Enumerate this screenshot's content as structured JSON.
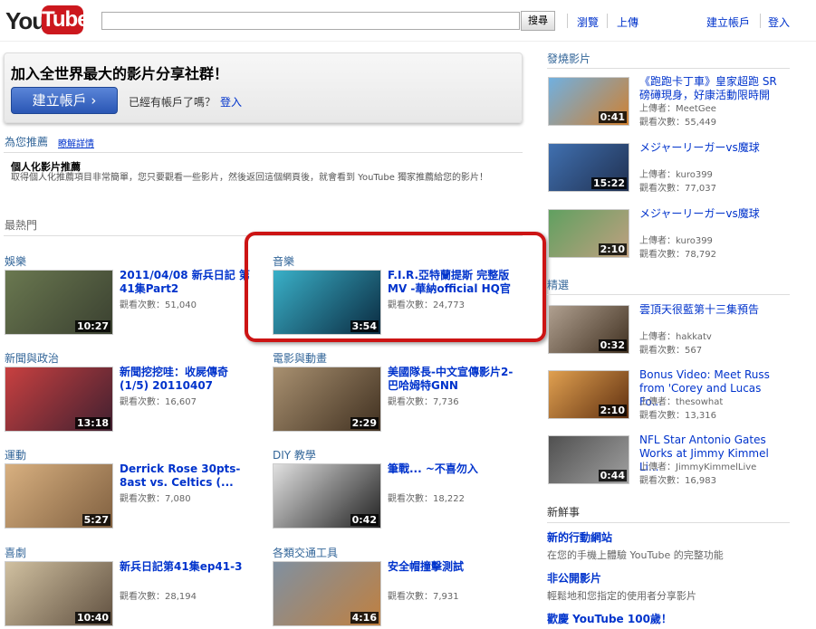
{
  "header": {
    "logo_you": "You",
    "logo_tube": "Tube",
    "search_placeholder": "",
    "search_button": "搜尋",
    "nav_browse": "瀏覽",
    "nav_upload": "上傳",
    "create_account": "建立帳戶",
    "sign_in": "登入"
  },
  "join": {
    "title": "加入全世界最大的影片分享社群！",
    "create_button": "建立帳戶 ›",
    "have_account": "已經有帳戶了嗎？",
    "sign_in": "登入"
  },
  "recommended": {
    "header": "為您推薦",
    "learn_more": "瞭解詳情",
    "title": "個人化影片推薦",
    "description": "取得個人化推薦項目非常簡單，您只要觀看一些影片，然後返回這個網頁後，就會看到 YouTube 獨家推薦給您的影片！"
  },
  "popular_header": "最熱門",
  "categories": [
    {
      "name": "娛樂",
      "title": "2011/04/08 新兵日記 第41集Part2",
      "views": "觀看次數：51,040",
      "duration": "10:27",
      "colors": [
        "#6a7850",
        "#3a4030"
      ]
    },
    {
      "name": "音樂",
      "title": "F.I.R.亞特蘭提斯 完整版MV -華納official HQ官",
      "views": "觀看次數：24,773",
      "duration": "3:54",
      "colors": [
        "#3ab0c8",
        "#0a2a40"
      ]
    },
    {
      "name": "新聞與政治",
      "title": "新聞挖挖哇：收屍傳奇(1/5) 20110407",
      "views": "觀看次數：16,607",
      "duration": "13:18",
      "colors": [
        "#c84040",
        "#402030"
      ]
    },
    {
      "name": "電影與動畫",
      "title": "美國隊長-中文宣傳影片2-巴哈姆特GNN",
      "views": "觀看次數：7,736",
      "duration": "2:29",
      "colors": [
        "#a89070",
        "#403020"
      ]
    },
    {
      "name": "運動",
      "title": "Derrick Rose 30pts-8ast vs. Celtics (...",
      "views": "觀看次數：7,080",
      "duration": "5:27",
      "colors": [
        "#d8b080",
        "#806040"
      ]
    },
    {
      "name": "DIY 教學",
      "title": "筆戰... ~不喜勿入",
      "views": "觀看次數：18,222",
      "duration": "0:42",
      "colors": [
        "#e0e0e0",
        "#202020"
      ]
    },
    {
      "name": "喜劇",
      "title": "新兵日記第41集ep41-3",
      "views": "觀看次數：28,194",
      "duration": "10:40",
      "colors": [
        "#d0c0a0",
        "#605040"
      ]
    },
    {
      "name": "各類交通工具",
      "title": "安全帽撞擊測試",
      "views": "觀看次數：7,931",
      "duration": "4:16",
      "colors": [
        "#8090a0",
        "#c08040"
      ]
    }
  ],
  "trending": {
    "header": "發燒影片",
    "items": [
      {
        "title": "《跑跑卡丁車》皇家超跑 SR 磅礡現身，好康活動限時開",
        "uploader": "上傳者：MeetGee",
        "views": "觀看次數：55,449",
        "duration": "0:41",
        "colors": [
          "#70b0e0",
          "#d08030"
        ]
      },
      {
        "title": "メジャーリーガーvs魔球",
        "uploader": "上傳者：kuro399",
        "views": "觀看次數：77,037",
        "duration": "15:22",
        "colors": [
          "#4070b0",
          "#203050"
        ]
      },
      {
        "title": "メジャーリーガーvs魔球",
        "uploader": "上傳者：kuro399",
        "views": "觀看次數：78,792",
        "duration": "2:10",
        "colors": [
          "#60a060",
          "#c0a080"
        ]
      }
    ]
  },
  "featured": {
    "header": "精選",
    "items": [
      {
        "title": "雲頂天很藍第十三集預告",
        "uploader": "上傳者：hakkatv",
        "views": "觀看次數：567",
        "duration": "0:32",
        "colors": [
          "#b0a090",
          "#403020"
        ]
      },
      {
        "title": "Bonus Video: Meet Russ from 'Corey and Lucas Fo...",
        "uploader": "上傳者：thesowhat",
        "views": "觀看次數：13,316",
        "duration": "2:10",
        "colors": [
          "#e0a050",
          "#603010"
        ]
      },
      {
        "title": "NFL Star Antonio Gates Works at Jimmy Kimmel Li...",
        "uploader": "上傳者：JimmyKimmelLive",
        "views": "觀看次數：16,983",
        "duration": "0:44",
        "colors": [
          "#505050",
          "#a0a0a0"
        ]
      }
    ]
  },
  "whats_new": {
    "header": "新鮮事",
    "items": [
      {
        "title": "新的行動網站",
        "desc": "在您的手機上體驗 YouTube 的完整功能"
      },
      {
        "title": "非公開影片",
        "desc": "輕鬆地和您指定的使用者分享影片"
      },
      {
        "title": "歡慶 YouTube 100歲！",
        "desc": ""
      }
    ]
  }
}
